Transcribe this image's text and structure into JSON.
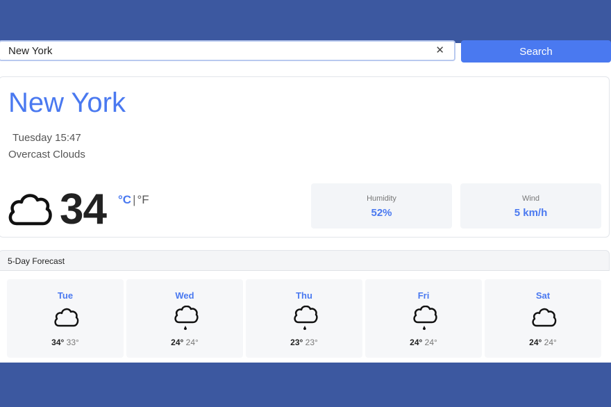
{
  "search": {
    "value": "New York",
    "clear_glyph": "✕",
    "button_label": "Search"
  },
  "current": {
    "city": "New York",
    "date_time": "Tuesday 15:47",
    "description": "Overcast Clouds",
    "temperature": "34",
    "unit_c": "°C",
    "unit_separator": "|",
    "unit_f": "°F",
    "icon": "cloud-icon",
    "humidity": {
      "label": "Humidity",
      "value": "52%"
    },
    "wind": {
      "label": "Wind",
      "value": "5 km/h"
    }
  },
  "forecast": {
    "title": "5-Day Forecast",
    "days": [
      {
        "day": "Tue",
        "high": "34°",
        "low": "33°",
        "icon": "cloud-icon"
      },
      {
        "day": "Wed",
        "high": "24°",
        "low": "24°",
        "icon": "rain-drop-cloud-icon"
      },
      {
        "day": "Thu",
        "high": "23°",
        "low": "23°",
        "icon": "rain-drop-cloud-icon"
      },
      {
        "day": "Fri",
        "high": "24°",
        "low": "24°",
        "icon": "rain-drop-cloud-icon"
      },
      {
        "day": "Sat",
        "high": "24°",
        "low": "24°",
        "icon": "cloud-icon"
      }
    ]
  },
  "colors": {
    "accent": "#4a79f0",
    "frame": "#3c58a0"
  }
}
